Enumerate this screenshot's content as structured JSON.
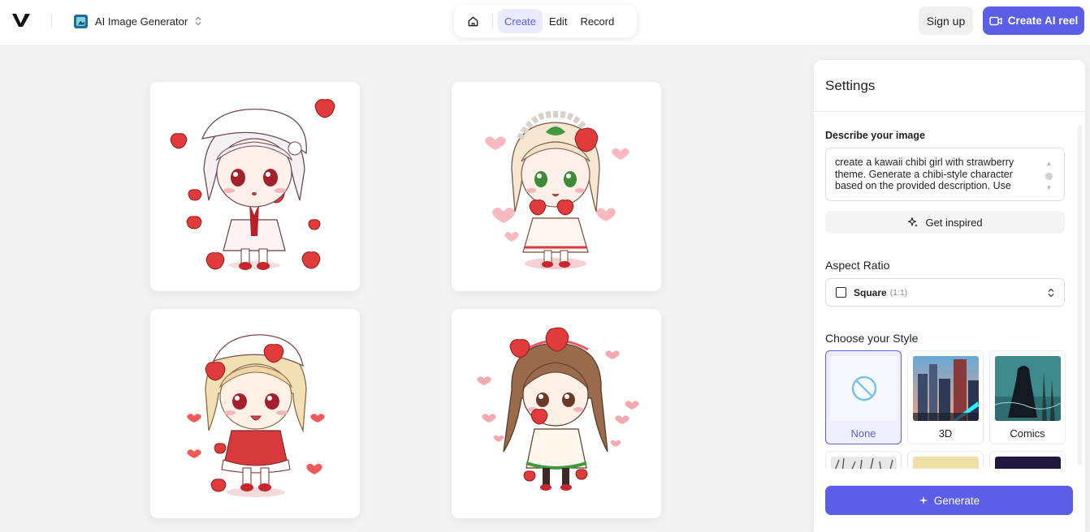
{
  "brand": {
    "logo_icon": "vimeo-v-logo-icon"
  },
  "app_switcher": {
    "title": "AI Image Generator",
    "icon": "image-app-icon"
  },
  "nav": {
    "home_icon": "home-icon",
    "tabs": [
      {
        "label": "Create",
        "active": true
      },
      {
        "label": "Edit",
        "active": false
      },
      {
        "label": "Record",
        "active": false
      }
    ]
  },
  "header_actions": {
    "sign_up": "Sign up",
    "create_reel": "Create AI reel"
  },
  "gallery": {
    "images": [
      {
        "name": "chibi-strawberry-girl-1",
        "hair": "white"
      },
      {
        "name": "chibi-strawberry-girl-2",
        "hair": "cream"
      },
      {
        "name": "chibi-strawberry-girl-3",
        "hair": "blonde"
      },
      {
        "name": "chibi-strawberry-girl-4",
        "hair": "brown"
      }
    ]
  },
  "settings": {
    "title": "Settings",
    "describe_label": "Describe your image",
    "prompt_text": "create a kawaii chibi girl with strawberry theme. Generate a chibi-style character based on the provided description. Use",
    "get_inspired": "Get inspired",
    "aspect_label": "Aspect Ratio",
    "aspect_value": "Square",
    "aspect_ratio": "(1:1)",
    "style_label": "Choose your Style",
    "styles": [
      {
        "label": "None",
        "selected": true
      },
      {
        "label": "3D",
        "selected": false
      },
      {
        "label": "Comics",
        "selected": false
      }
    ],
    "generate": "Generate"
  },
  "colors": {
    "accent": "#5b5fe8",
    "accent_soft": "#e9ebfd",
    "strawberry": "#e23b3b"
  }
}
